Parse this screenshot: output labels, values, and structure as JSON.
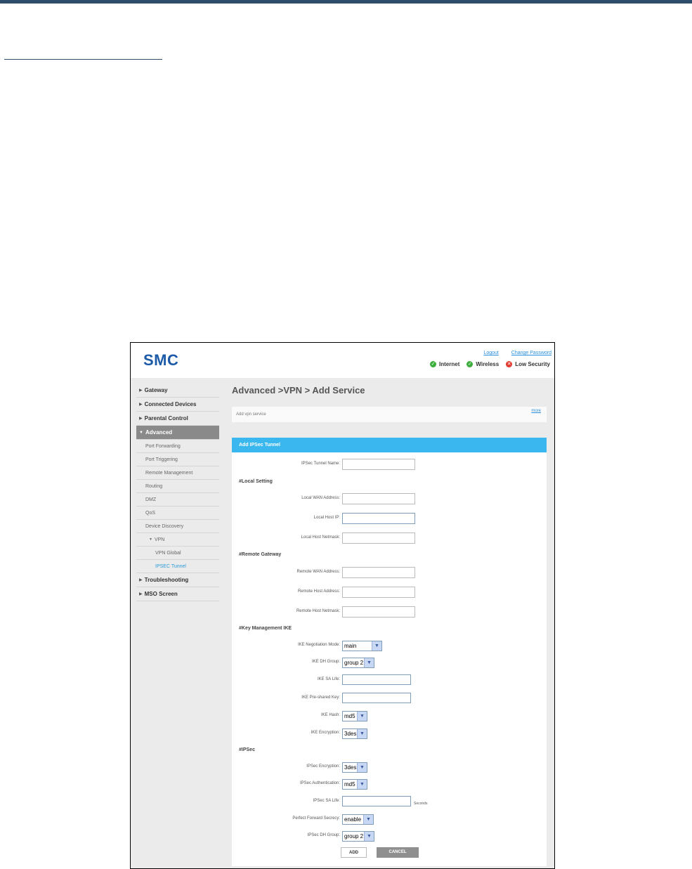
{
  "header": {
    "logo": "SMC",
    "logout": "Logout",
    "change_password": "Change Password",
    "status": [
      {
        "label": "Internet",
        "state": "ok"
      },
      {
        "label": "Wireless",
        "state": "ok"
      },
      {
        "label": "Low Security",
        "state": "bad"
      }
    ],
    "ok_color": "#3cae3c",
    "bad_color": "#e23a2e"
  },
  "sidebar": {
    "gateway": "Gateway",
    "connected_devices": "Connected Devices",
    "parental_control": "Parental Control",
    "advanced": "Advanced",
    "port_forwarding": "Port Forwarding",
    "port_triggering": "Port Triggering",
    "remote_management": "Remote Management",
    "routing": "Routing",
    "dmz": "DMZ",
    "qos": "QoS",
    "device_discovery": "Device Discovery",
    "vpn": "VPN",
    "vpn_global": "VPN Global",
    "ipsec_tunnel": "IPSEC Tunnel",
    "troubleshooting": "Troubleshooting",
    "mso_screen": "MSO Screen"
  },
  "main": {
    "title": "Advanced >VPN > Add Service",
    "description": "Add vpn service",
    "more": "more",
    "panel_title": "Add IPSec Tunnel",
    "tunnel_name_label": "IPSec Tunnel Name:",
    "local_setting": "#Local Setting",
    "local_wan_label": "Local WAN Address:",
    "local_host_ip_label": "Local Host IP:",
    "local_host_netmask_label": "Local Host Netmask:",
    "remote_gateway": "#Remote Gateway",
    "remote_wan_label": "Remote WAN Address:",
    "remote_host_address_label": "Remote Host Address:",
    "remote_host_netmask_label": "Remote Host Netmask:",
    "key_mgmt": "#Key Management IKE",
    "ike_negotiation_label": "IKE Negotiation Mode:",
    "ike_negotiation_value": "main",
    "ike_dh_label": "IKE DH Group:",
    "ike_dh_value": "group 2",
    "ike_sa_life_label": "IKE SA Life:",
    "ike_psk_label": "IKE Pre-shared Key:",
    "ike_hash_label": "IKE Hash:",
    "ike_hash_value": "md5",
    "ike_enc_label": "IKE Encryption:",
    "ike_enc_value": "3des",
    "ipsec_section": "#IPSec",
    "ipsec_enc_label": "IPSec Encryption:",
    "ipsec_enc_value": "3des",
    "ipsec_auth_label": "IPSec Authentication:",
    "ipsec_auth_value": "md5",
    "ipsec_sa_life_label": "IPSec SA Life:",
    "seconds": "Seconds",
    "pfs_label": "Perfect Forward Secrecy:",
    "pfs_value": "enable",
    "ipsec_dh_label": "IPSec DH Group:",
    "ipsec_dh_value": "group 2",
    "add": "ADD",
    "cancel": "CANCEL"
  }
}
